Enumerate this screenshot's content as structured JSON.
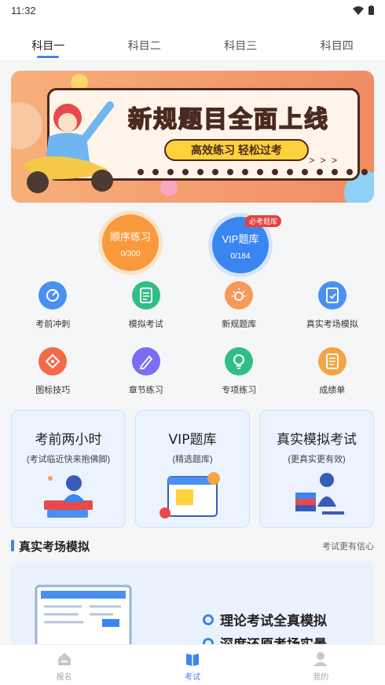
{
  "status_bar": {
    "time": "11:32"
  },
  "tabs": [
    {
      "label": "科目一",
      "active": true
    },
    {
      "label": "科目二",
      "active": false
    },
    {
      "label": "科目三",
      "active": false
    },
    {
      "label": "科目四",
      "active": false
    }
  ],
  "banner": {
    "title": "新规题目全面上线",
    "subtitle": "高效练习 轻松过考",
    "arrows": "> > >"
  },
  "practice": {
    "sequential": {
      "label": "顺序练习",
      "count": "0/300"
    },
    "vip": {
      "label": "VIP题库",
      "count": "0/184",
      "badge": "必考题库"
    }
  },
  "grid_row1": [
    {
      "label": "考前冲刺",
      "icon": "target-icon",
      "color": "#4a90f2"
    },
    {
      "label": "模拟考试",
      "icon": "document-icon",
      "color": "#2fbf86"
    },
    {
      "label": "新规题库",
      "icon": "bulb-sun-icon",
      "color": "#f59a5a"
    },
    {
      "label": "真实考场模拟",
      "icon": "exam-paper-icon",
      "color": "#4a90f2"
    }
  ],
  "grid_row2": [
    {
      "label": "图标技巧",
      "icon": "sign-icon",
      "color": "#f26a4a"
    },
    {
      "label": "章节练习",
      "icon": "pencil-icon",
      "color": "#7b6ef2"
    },
    {
      "label": "专项练习",
      "icon": "lightbulb-icon",
      "color": "#2fbf86"
    },
    {
      "label": "成绩单",
      "icon": "report-icon",
      "color": "#f5a442"
    }
  ],
  "cards": [
    {
      "title": "考前两小时",
      "subtitle": "(考试临近快来抱佛脚)"
    },
    {
      "title": "VIP题库",
      "subtitle": "(精选题库)"
    },
    {
      "title": "真实模拟考试",
      "subtitle": "(更真实更有效)"
    }
  ],
  "section": {
    "title": "真实考场模拟",
    "more": "考试更有信心"
  },
  "simulation": {
    "line1": "理论考试全真模拟",
    "line2": "深度还原考场实景"
  },
  "bottom_nav": [
    {
      "label": "报名",
      "icon": "home-icon",
      "active": false
    },
    {
      "label": "考试",
      "icon": "book-icon",
      "active": true
    },
    {
      "label": "我的",
      "icon": "profile-icon",
      "active": false
    }
  ],
  "colors": {
    "accent": "#3a86f0",
    "orange": "#f89a3c",
    "badge_red": "#e8403c"
  }
}
